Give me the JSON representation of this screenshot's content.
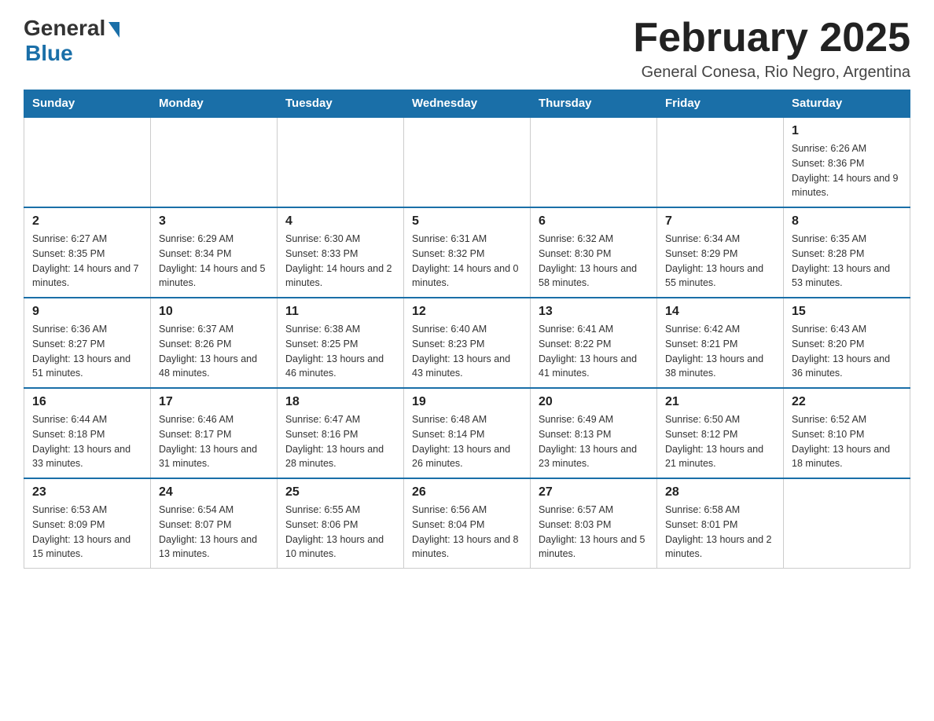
{
  "logo": {
    "general": "General",
    "blue": "Blue"
  },
  "title": {
    "month_year": "February 2025",
    "location": "General Conesa, Rio Negro, Argentina"
  },
  "weekdays": [
    "Sunday",
    "Monday",
    "Tuesday",
    "Wednesday",
    "Thursday",
    "Friday",
    "Saturday"
  ],
  "weeks": [
    [
      {
        "day": "",
        "info": ""
      },
      {
        "day": "",
        "info": ""
      },
      {
        "day": "",
        "info": ""
      },
      {
        "day": "",
        "info": ""
      },
      {
        "day": "",
        "info": ""
      },
      {
        "day": "",
        "info": ""
      },
      {
        "day": "1",
        "info": "Sunrise: 6:26 AM\nSunset: 8:36 PM\nDaylight: 14 hours and 9 minutes."
      }
    ],
    [
      {
        "day": "2",
        "info": "Sunrise: 6:27 AM\nSunset: 8:35 PM\nDaylight: 14 hours and 7 minutes."
      },
      {
        "day": "3",
        "info": "Sunrise: 6:29 AM\nSunset: 8:34 PM\nDaylight: 14 hours and 5 minutes."
      },
      {
        "day": "4",
        "info": "Sunrise: 6:30 AM\nSunset: 8:33 PM\nDaylight: 14 hours and 2 minutes."
      },
      {
        "day": "5",
        "info": "Sunrise: 6:31 AM\nSunset: 8:32 PM\nDaylight: 14 hours and 0 minutes."
      },
      {
        "day": "6",
        "info": "Sunrise: 6:32 AM\nSunset: 8:30 PM\nDaylight: 13 hours and 58 minutes."
      },
      {
        "day": "7",
        "info": "Sunrise: 6:34 AM\nSunset: 8:29 PM\nDaylight: 13 hours and 55 minutes."
      },
      {
        "day": "8",
        "info": "Sunrise: 6:35 AM\nSunset: 8:28 PM\nDaylight: 13 hours and 53 minutes."
      }
    ],
    [
      {
        "day": "9",
        "info": "Sunrise: 6:36 AM\nSunset: 8:27 PM\nDaylight: 13 hours and 51 minutes."
      },
      {
        "day": "10",
        "info": "Sunrise: 6:37 AM\nSunset: 8:26 PM\nDaylight: 13 hours and 48 minutes."
      },
      {
        "day": "11",
        "info": "Sunrise: 6:38 AM\nSunset: 8:25 PM\nDaylight: 13 hours and 46 minutes."
      },
      {
        "day": "12",
        "info": "Sunrise: 6:40 AM\nSunset: 8:23 PM\nDaylight: 13 hours and 43 minutes."
      },
      {
        "day": "13",
        "info": "Sunrise: 6:41 AM\nSunset: 8:22 PM\nDaylight: 13 hours and 41 minutes."
      },
      {
        "day": "14",
        "info": "Sunrise: 6:42 AM\nSunset: 8:21 PM\nDaylight: 13 hours and 38 minutes."
      },
      {
        "day": "15",
        "info": "Sunrise: 6:43 AM\nSunset: 8:20 PM\nDaylight: 13 hours and 36 minutes."
      }
    ],
    [
      {
        "day": "16",
        "info": "Sunrise: 6:44 AM\nSunset: 8:18 PM\nDaylight: 13 hours and 33 minutes."
      },
      {
        "day": "17",
        "info": "Sunrise: 6:46 AM\nSunset: 8:17 PM\nDaylight: 13 hours and 31 minutes."
      },
      {
        "day": "18",
        "info": "Sunrise: 6:47 AM\nSunset: 8:16 PM\nDaylight: 13 hours and 28 minutes."
      },
      {
        "day": "19",
        "info": "Sunrise: 6:48 AM\nSunset: 8:14 PM\nDaylight: 13 hours and 26 minutes."
      },
      {
        "day": "20",
        "info": "Sunrise: 6:49 AM\nSunset: 8:13 PM\nDaylight: 13 hours and 23 minutes."
      },
      {
        "day": "21",
        "info": "Sunrise: 6:50 AM\nSunset: 8:12 PM\nDaylight: 13 hours and 21 minutes."
      },
      {
        "day": "22",
        "info": "Sunrise: 6:52 AM\nSunset: 8:10 PM\nDaylight: 13 hours and 18 minutes."
      }
    ],
    [
      {
        "day": "23",
        "info": "Sunrise: 6:53 AM\nSunset: 8:09 PM\nDaylight: 13 hours and 15 minutes."
      },
      {
        "day": "24",
        "info": "Sunrise: 6:54 AM\nSunset: 8:07 PM\nDaylight: 13 hours and 13 minutes."
      },
      {
        "day": "25",
        "info": "Sunrise: 6:55 AM\nSunset: 8:06 PM\nDaylight: 13 hours and 10 minutes."
      },
      {
        "day": "26",
        "info": "Sunrise: 6:56 AM\nSunset: 8:04 PM\nDaylight: 13 hours and 8 minutes."
      },
      {
        "day": "27",
        "info": "Sunrise: 6:57 AM\nSunset: 8:03 PM\nDaylight: 13 hours and 5 minutes."
      },
      {
        "day": "28",
        "info": "Sunrise: 6:58 AM\nSunset: 8:01 PM\nDaylight: 13 hours and 2 minutes."
      },
      {
        "day": "",
        "info": ""
      }
    ]
  ]
}
